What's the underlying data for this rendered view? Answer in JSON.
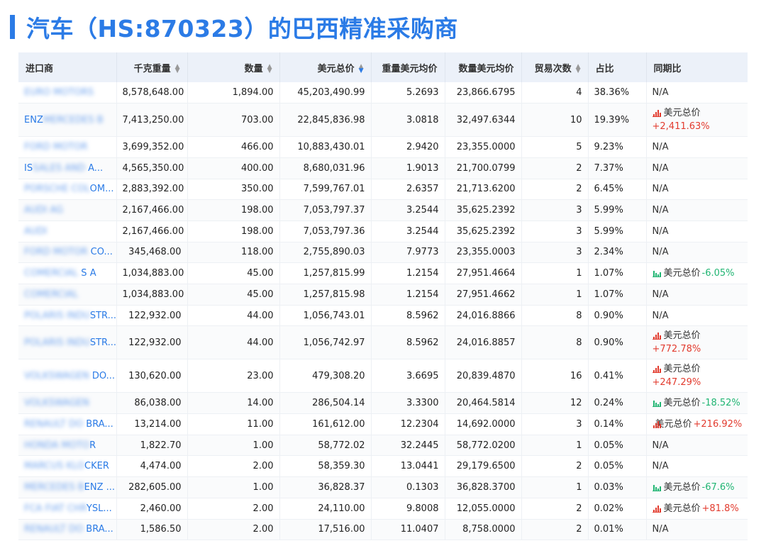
{
  "title": "汽车（HS:870323）的巴西精准采购商",
  "columns": {
    "importer": "进口商",
    "kg_weight": "千克重量",
    "quantity": "数量",
    "usd_total": "美元总价",
    "usd_per_weight": "重量美元均价",
    "usd_per_qty": "数量美元均价",
    "trade_count": "贸易次数",
    "share": "占比",
    "yoy": "同期比"
  },
  "yoy_metric_label": "美元总价",
  "rows": [
    {
      "importer_visible": "",
      "importer_masked": "EURO MOTORS",
      "kg": "8,578,648.00",
      "qty": "1,894.00",
      "usd": "45,203,490.99",
      "usd_w": "5.2693",
      "usd_q": "23,866.6795",
      "trades": "4",
      "share": "38.36%",
      "yoy": "N/A",
      "yoy_dir": "none"
    },
    {
      "importer_visible": "ENZ",
      "importer_masked": "MERCEDES B",
      "kg": "7,413,250.00",
      "qty": "703.00",
      "usd": "22,845,836.98",
      "usd_w": "3.0818",
      "usd_q": "32,497.6344",
      "trades": "10",
      "share": "19.39%",
      "yoy": "+2,411.63%",
      "yoy_dir": "up"
    },
    {
      "importer_visible": "",
      "importer_masked": "FORD MOTOR",
      "kg": "3,699,352.00",
      "qty": "466.00",
      "usd": "10,883,430.01",
      "usd_w": "2.9420",
      "usd_q": "23,355.0000",
      "trades": "5",
      "share": "9.23%",
      "yoy": "N/A",
      "yoy_dir": "none"
    },
    {
      "importer_visible": "IS",
      "importer_masked": "SALES AND",
      "importer_suffix": " A...",
      "kg": "4,565,350.00",
      "qty": "400.00",
      "usd": "8,680,031.96",
      "usd_w": "1.9013",
      "usd_q": "21,700.0799",
      "trades": "2",
      "share": "7.37%",
      "yoy": "N/A",
      "yoy_dir": "none"
    },
    {
      "importer_visible": "",
      "importer_masked": "PORSCHE COL",
      "importer_suffix": "OM...",
      "kg": "2,883,392.00",
      "qty": "350.00",
      "usd": "7,599,767.01",
      "usd_w": "2.6357",
      "usd_q": "21,713.6200",
      "trades": "2",
      "share": "6.45%",
      "yoy": "N/A",
      "yoy_dir": "none"
    },
    {
      "importer_visible": "",
      "importer_masked": "AUDI AG",
      "kg": "2,167,466.00",
      "qty": "198.00",
      "usd": "7,053,797.37",
      "usd_w": "3.2544",
      "usd_q": "35,625.2392",
      "trades": "3",
      "share": "5.99%",
      "yoy": "N/A",
      "yoy_dir": "none"
    },
    {
      "importer_visible": "",
      "importer_masked": "AUDI",
      "kg": "2,167,466.00",
      "qty": "198.00",
      "usd": "7,053,797.36",
      "usd_w": "3.2544",
      "usd_q": "35,625.2392",
      "trades": "3",
      "share": "5.99%",
      "yoy": "N/A",
      "yoy_dir": "none"
    },
    {
      "importer_visible": "",
      "importer_masked": "FORD MOTOR",
      "importer_suffix": " CO...",
      "kg": "345,468.00",
      "qty": "118.00",
      "usd": "2,755,890.03",
      "usd_w": "7.9773",
      "usd_q": "23,355.0003",
      "trades": "3",
      "share": "2.34%",
      "yoy": "N/A",
      "yoy_dir": "none"
    },
    {
      "importer_visible": "",
      "importer_masked": "COMERCIAL",
      "importer_suffix": " S A",
      "kg": "1,034,883.00",
      "qty": "45.00",
      "usd": "1,257,815.99",
      "usd_w": "1.2154",
      "usd_q": "27,951.4664",
      "trades": "1",
      "share": "1.07%",
      "yoy": "-6.05%",
      "yoy_dir": "down"
    },
    {
      "importer_visible": "",
      "importer_masked": "COMERCIAL",
      "kg": "1,034,883.00",
      "qty": "45.00",
      "usd": "1,257,815.98",
      "usd_w": "1.2154",
      "usd_q": "27,951.4662",
      "trades": "1",
      "share": "1.07%",
      "yoy": "N/A",
      "yoy_dir": "none"
    },
    {
      "importer_visible": "",
      "importer_masked": "POLARIS INDU",
      "importer_suffix": "STR...",
      "kg": "122,932.00",
      "qty": "44.00",
      "usd": "1,056,743.01",
      "usd_w": "8.5962",
      "usd_q": "24,016.8866",
      "trades": "8",
      "share": "0.90%",
      "yoy": "N/A",
      "yoy_dir": "none"
    },
    {
      "importer_visible": "",
      "importer_masked": "POLARIS INDU",
      "importer_suffix": "STR...",
      "kg": "122,932.00",
      "qty": "44.00",
      "usd": "1,056,742.97",
      "usd_w": "8.5962",
      "usd_q": "24,016.8857",
      "trades": "8",
      "share": "0.90%",
      "yoy": "+772.78%",
      "yoy_dir": "up"
    },
    {
      "importer_visible": "",
      "importer_masked": "VOLKSWAGEN",
      "importer_suffix": " DO...",
      "kg": "130,620.00",
      "qty": "23.00",
      "usd": "479,308.20",
      "usd_w": "3.6695",
      "usd_q": "20,839.4870",
      "trades": "16",
      "share": "0.41%",
      "yoy": "+247.29%",
      "yoy_dir": "up"
    },
    {
      "importer_visible": "",
      "importer_masked": "VOLKSWAGEN",
      "kg": "86,038.00",
      "qty": "14.00",
      "usd": "286,504.14",
      "usd_w": "3.3300",
      "usd_q": "20,464.5814",
      "trades": "12",
      "share": "0.24%",
      "yoy": "-18.52%",
      "yoy_dir": "down"
    },
    {
      "importer_visible": "",
      "importer_masked": "RENAULT DO",
      "importer_suffix": " BRA...",
      "kg": "13,214.00",
      "qty": "11.00",
      "usd": "161,612.00",
      "usd_w": "12.2304",
      "usd_q": "14,692.0000",
      "trades": "3",
      "share": "0.14%",
      "yoy": "+216.92%",
      "yoy_dir": "up"
    },
    {
      "importer_visible": "",
      "importer_masked": "HONDA MOTO",
      "importer_suffix": "R",
      "kg": "1,822.70",
      "qty": "1.00",
      "usd": "58,772.02",
      "usd_w": "32.2445",
      "usd_q": "58,772.0200",
      "trades": "1",
      "share": "0.05%",
      "yoy": "N/A",
      "yoy_dir": "none"
    },
    {
      "importer_visible": "",
      "importer_masked": "MARCUS KLO",
      "importer_suffix": "CKER",
      "kg": "4,474.00",
      "qty": "2.00",
      "usd": "58,359.30",
      "usd_w": "13.0441",
      "usd_q": "29,179.6500",
      "trades": "2",
      "share": "0.05%",
      "yoy": "N/A",
      "yoy_dir": "none"
    },
    {
      "importer_visible": "",
      "importer_masked": "MERCEDES B",
      "importer_suffix": "ENZ ...",
      "kg": "282,605.00",
      "qty": "1.00",
      "usd": "36,828.37",
      "usd_w": "0.1303",
      "usd_q": "36,828.3700",
      "trades": "1",
      "share": "0.03%",
      "yoy": "-67.6%",
      "yoy_dir": "down"
    },
    {
      "importer_visible": "",
      "importer_masked": "FCA FIAT CHR",
      "importer_suffix": "YSL...",
      "kg": "2,460.00",
      "qty": "2.00",
      "usd": "24,110.00",
      "usd_w": "9.8008",
      "usd_q": "12,055.0000",
      "trades": "2",
      "share": "0.02%",
      "yoy": "+81.8%",
      "yoy_dir": "up"
    },
    {
      "importer_visible": "",
      "importer_masked": "RENAULT DO",
      "importer_suffix": " BRA...",
      "kg": "1,586.50",
      "qty": "2.00",
      "usd": "17,516.00",
      "usd_w": "11.0407",
      "usd_q": "8,758.0000",
      "trades": "2",
      "share": "0.01%",
      "yoy": "N/A",
      "yoy_dir": "none"
    }
  ],
  "colors": {
    "accent": "#2b7be6",
    "up": "#e23b2e",
    "down": "#21b573",
    "header_bg": "#ecf1f9"
  }
}
